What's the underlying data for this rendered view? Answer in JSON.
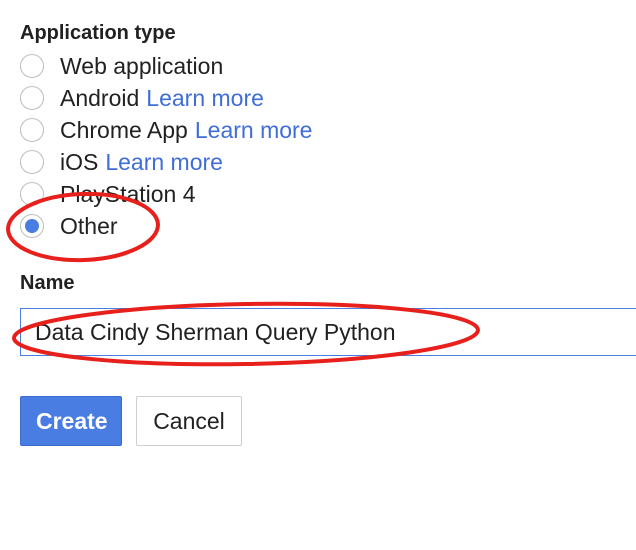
{
  "application_type": {
    "label": "Application type",
    "options": [
      {
        "label": "Web application",
        "link": "",
        "selected": false
      },
      {
        "label": "Android",
        "link": "Learn more",
        "selected": false
      },
      {
        "label": "Chrome App",
        "link": "Learn more",
        "selected": false
      },
      {
        "label": "iOS",
        "link": "Learn more",
        "selected": false
      },
      {
        "label": "PlayStation 4",
        "link": "",
        "selected": false
      },
      {
        "label": "Other",
        "link": "",
        "selected": true
      }
    ]
  },
  "name_field": {
    "label": "Name",
    "value": "Data Cindy Sherman Query Python"
  },
  "buttons": {
    "create": "Create",
    "cancel": "Cancel"
  },
  "colors": {
    "accent": "#4a7de2",
    "link": "#3f6ed8",
    "annotation": "#e8201c"
  }
}
